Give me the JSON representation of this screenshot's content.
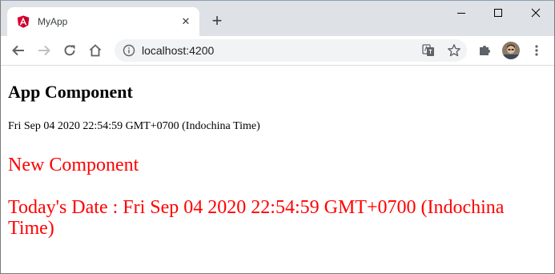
{
  "browser": {
    "tab": {
      "title": "MyApp",
      "favicon": "angular-icon",
      "close_icon": "close-icon"
    },
    "new_tab_icon": "plus-icon",
    "window_controls": [
      "minimize-icon",
      "maximize-icon",
      "close-icon"
    ],
    "toolbar": {
      "back_icon": "arrow-left-icon",
      "forward_icon": "arrow-right-icon",
      "reload_icon": "reload-icon",
      "home_icon": "home-icon",
      "site_info_icon": "info-icon",
      "url": "localhost:4200",
      "translate_icon": "translate-icon",
      "bookmark_icon": "star-icon",
      "extensions_icon": "puzzle-icon",
      "profile_icon": "avatar",
      "menu_icon": "kebab-menu-icon"
    },
    "colors": {
      "tab_strip": "#dee1e6",
      "omnibox": "#f1f3f4",
      "angular_red": "#dd0031",
      "text_red": "#ff0000"
    }
  },
  "page": {
    "heading": "App Component",
    "date_text": "Fri Sep 04 2020 22:54:59 GMT+0700 (Indochina Time)",
    "new_component_title": "New Component",
    "todays_date": "Today's Date : Fri Sep 04 2020 22:54:59 GMT+0700 (Indochina Time)"
  }
}
